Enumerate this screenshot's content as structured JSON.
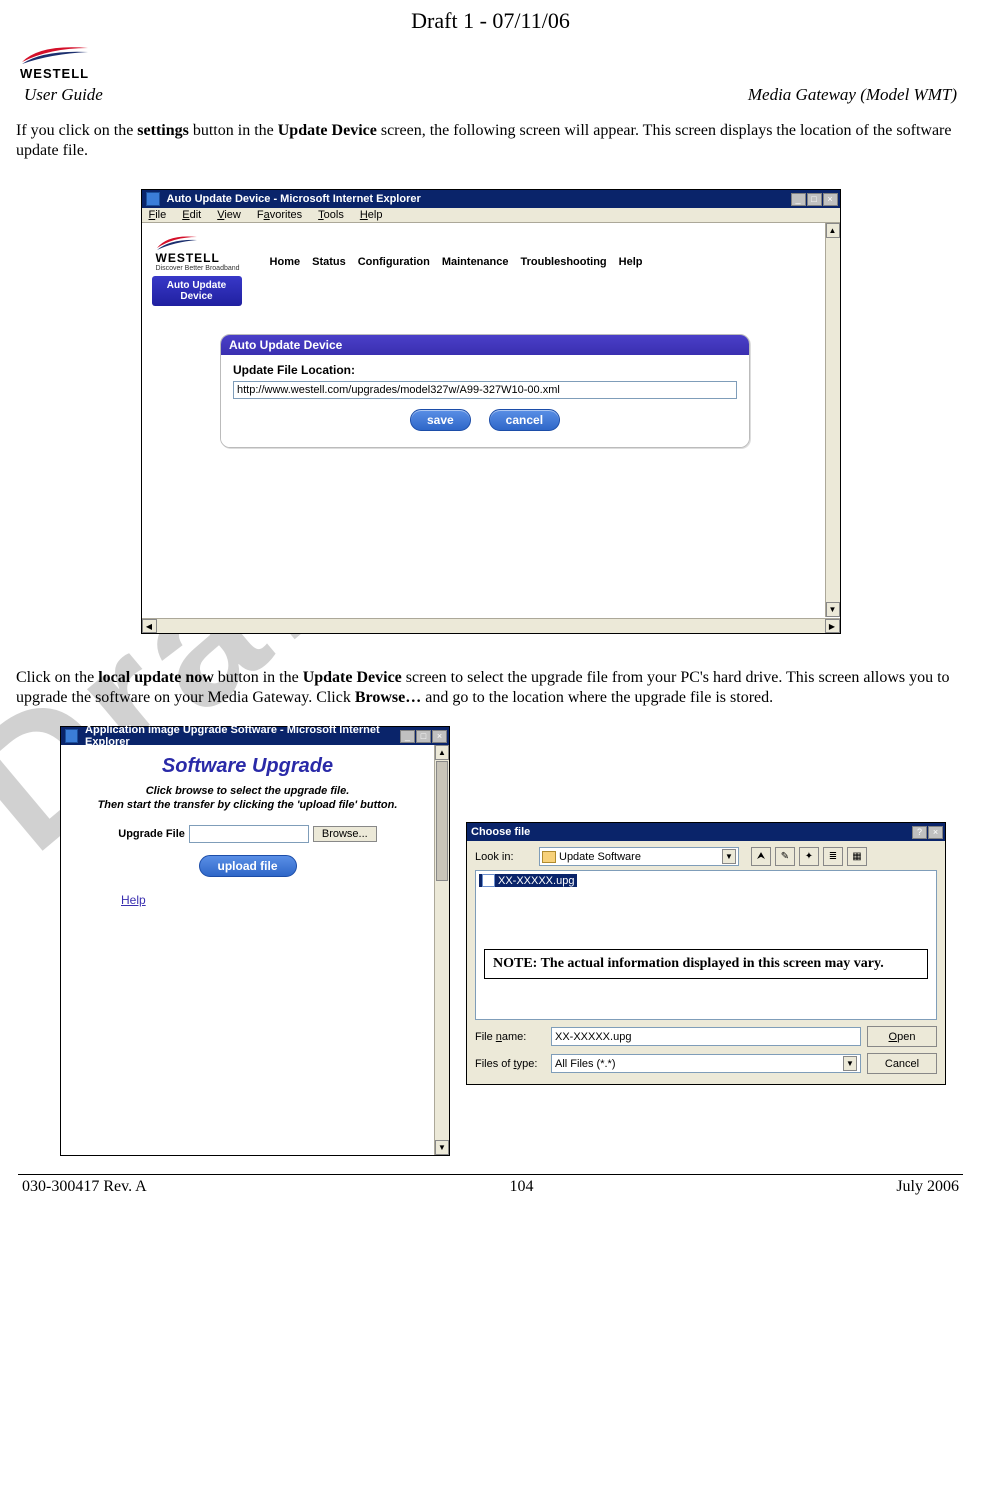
{
  "draft_header": "Draft 1 - 07/11/06",
  "header": {
    "brand": "WESTELL",
    "left": "User Guide",
    "right": "Media Gateway (Model WMT)"
  },
  "para1_a": "If you click on the ",
  "para1_b": "settings",
  "para1_c": " button in the ",
  "para1_d": "Update Device",
  "para1_e": " screen, the following screen will appear. This screen displays the location of the software update file.",
  "shot1": {
    "title": "Auto Update Device - Microsoft Internet Explorer",
    "menus": {
      "file": "File",
      "edit": "Edit",
      "view": "View",
      "fav": "Favorites",
      "tools": "Tools",
      "help": "Help"
    },
    "brand": "WESTELL",
    "tagline": "Discover Better Broadband",
    "nav": [
      "Home",
      "Status",
      "Configuration",
      "Maintenance",
      "Troubleshooting",
      "Help"
    ],
    "tab": "Auto Update Device",
    "card_title": "Auto Update Device",
    "update_label": "Update File Location:",
    "update_value": "http://www.westell.com/upgrades/model327w/A99-327W10-00.xml",
    "save": "save",
    "cancel": "cancel"
  },
  "para2_a": "Click on the ",
  "para2_b": "local update now",
  "para2_c": " button in the ",
  "para2_d": "Update Device",
  "para2_e": " screen to select the upgrade file from your PC's hard drive. This screen allows you to upgrade the software on your Media Gateway. Click ",
  "para2_f": "Browse…",
  "para2_g": " and go to the location where the upgrade file is stored.",
  "shot2": {
    "title": "Application image Upgrade Software - Microsoft Internet Explorer",
    "heading": "Software Upgrade",
    "sub1": "Click browse to select the upgrade file.",
    "sub2": "Then start the transfer by clicking the 'upload file' button.",
    "label": "Upgrade File",
    "browse": "Browse...",
    "upload": "upload file",
    "help": "Help"
  },
  "shot3": {
    "title": "Choose file",
    "lookin": "Look in:",
    "folder": "Update Software",
    "file_item": "XX-XXXXX.upg",
    "note": "NOTE: The actual information displayed in this screen may vary.",
    "file_name_lbl": "File name:",
    "file_name_val": "XX-XXXXX.upg",
    "types_lbl": "Files of type:",
    "types_val": "All Files (*.*)",
    "open": "Open",
    "cancel": "Cancel"
  },
  "footer": {
    "left": "030-300417 Rev. A",
    "center": "104",
    "right": "July 2006"
  },
  "watermark": "Draft"
}
